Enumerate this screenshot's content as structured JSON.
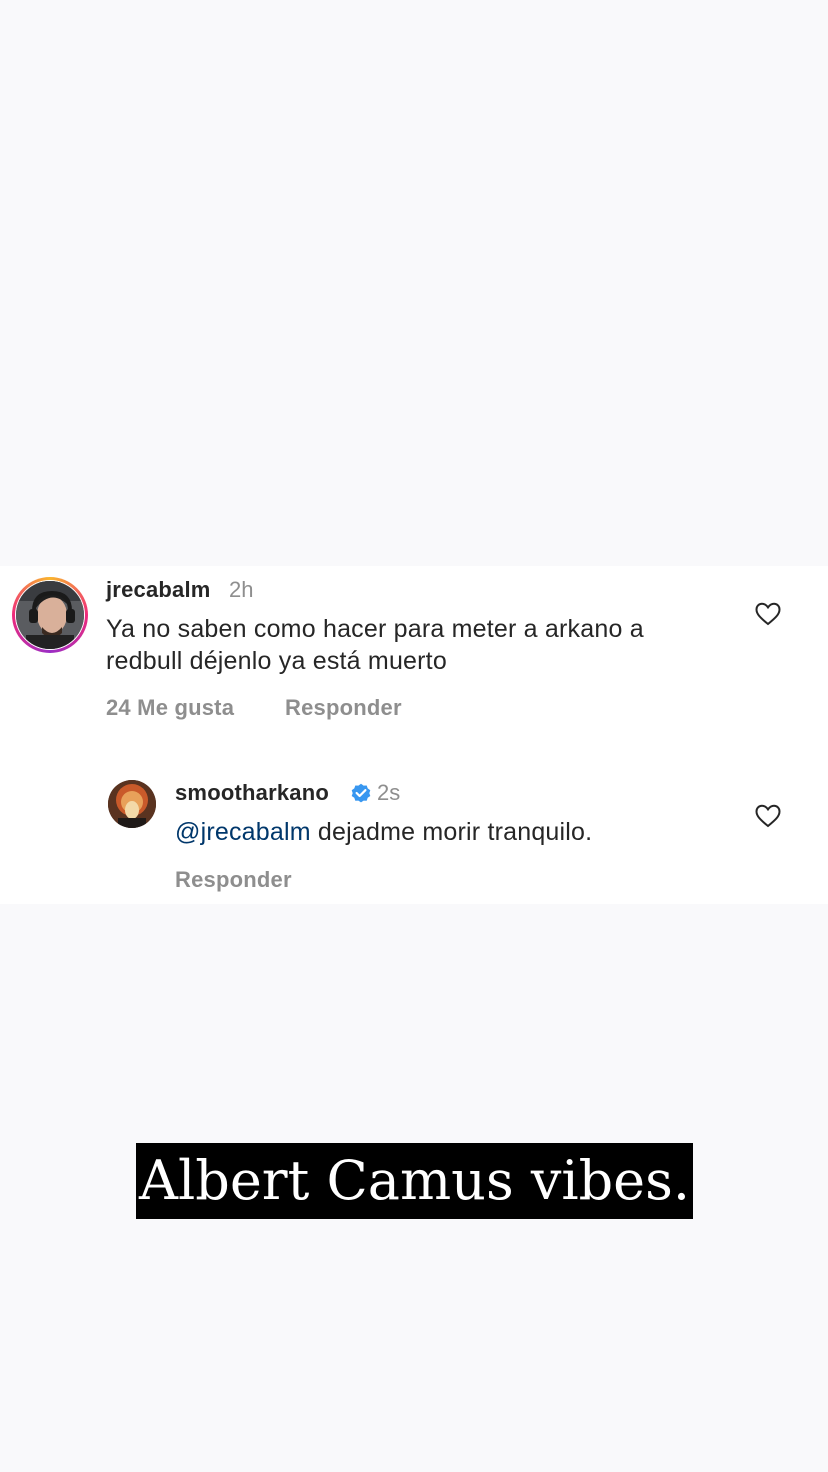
{
  "comments": [
    {
      "username": "jrecabalm",
      "time": "2h",
      "text_line1": "Ya no saben como hacer para meter a arkano a",
      "text_line2": "redbull déjenlo ya está muerto",
      "likes_label": "24 Me gusta",
      "reply_label": "Responder",
      "avatar_icon": "user-avatar-with-headphones",
      "story_ring": true
    },
    {
      "username": "smootharkano",
      "verified": true,
      "time": "2s",
      "mention": "@jrecabalm",
      "text": "dejadme morir tranquilo.",
      "reply_label": "Responder",
      "avatar_icon": "user-avatar"
    }
  ],
  "icons": {
    "like": "heart-outline-icon",
    "verified": "verified-badge-icon"
  },
  "colors": {
    "background": "#f9f9fb",
    "card": "#ffffff",
    "text": "#262626",
    "muted": "#8e8e8e",
    "mention": "#00376b",
    "verified_blue": "#3897f0",
    "caption_bg": "#000000",
    "caption_text": "#ffffff"
  },
  "caption": "Albert Camus vibes."
}
